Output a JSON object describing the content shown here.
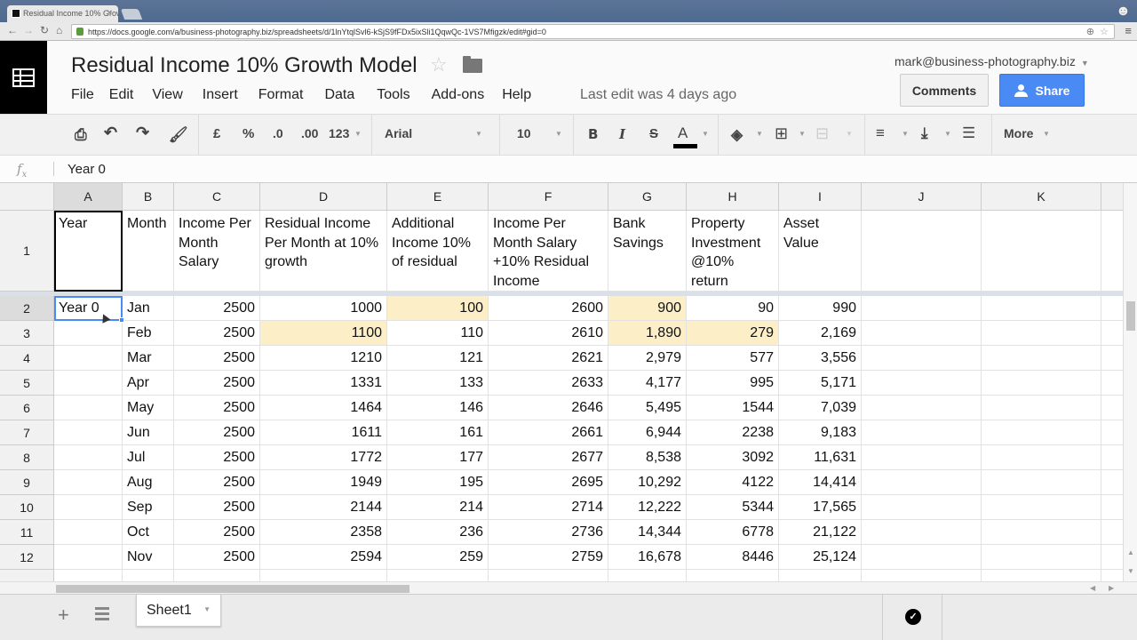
{
  "browser": {
    "tab_title": "Residual Income 10% Grow",
    "url": "https://docs.google.com/a/business-photography.biz/spreadsheets/d/1lnYtqlSvl6-kSjS9fFDx5ixSli1QqwQc-1VS7Mfigzk/edit#gid=0"
  },
  "app": {
    "doc_title": "Residual Income 10% Growth Model",
    "menus": [
      "File",
      "Edit",
      "View",
      "Insert",
      "Format",
      "Data",
      "Tools",
      "Add-ons",
      "Help"
    ],
    "last_edit": "Last edit was 4 days ago",
    "account": "mark@business-photography.biz",
    "comments_label": "Comments",
    "share_label": "Share"
  },
  "toolbar": {
    "currency": "£",
    "percent": "%",
    "dec_decrease": ".0",
    "dec_increase": ".00",
    "number_format": "123",
    "font": "Arial",
    "font_size": "10",
    "bold": "B",
    "italic": "I",
    "strike": "S",
    "text_color": "A",
    "more": "More"
  },
  "formula_bar": {
    "fx": "fx",
    "value": "Year 0"
  },
  "grid": {
    "columns": [
      "A",
      "B",
      "C",
      "D",
      "E",
      "F",
      "G",
      "H",
      "I",
      "J",
      "K"
    ],
    "selected_cell": "A2",
    "header_row": {
      "row": "1",
      "cells": [
        "Year",
        "Month",
        "Income Per Month Salary",
        "Residual Income Per Month at 10% growth",
        "Additional Income 10% of residual",
        "Income Per Month Salary +10% Residual Income",
        "Bank Savings",
        "Property Investment @10% return",
        "Asset Value",
        "",
        ""
      ]
    },
    "rows": [
      {
        "row": "2",
        "cells": [
          "Year 0",
          "Jan",
          "2500",
          "1000",
          "100",
          "2600",
          "900",
          "90",
          "990",
          "",
          ""
        ]
      },
      {
        "row": "3",
        "cells": [
          "",
          "Feb",
          "2500",
          "1100",
          "110",
          "2610",
          "1,890",
          "279",
          "2,169",
          "",
          ""
        ]
      },
      {
        "row": "4",
        "cells": [
          "",
          "Mar",
          "2500",
          "1210",
          "121",
          "2621",
          "2,979",
          "577",
          "3,556",
          "",
          ""
        ]
      },
      {
        "row": "5",
        "cells": [
          "",
          "Apr",
          "2500",
          "1331",
          "133",
          "2633",
          "4,177",
          "995",
          "5,171",
          "",
          ""
        ]
      },
      {
        "row": "6",
        "cells": [
          "",
          "May",
          "2500",
          "1464",
          "146",
          "2646",
          "5,495",
          "1544",
          "7,039",
          "",
          ""
        ]
      },
      {
        "row": "7",
        "cells": [
          "",
          "Jun",
          "2500",
          "1611",
          "161",
          "2661",
          "6,944",
          "2238",
          "9,183",
          "",
          ""
        ]
      },
      {
        "row": "8",
        "cells": [
          "",
          "Jul",
          "2500",
          "1772",
          "177",
          "2677",
          "8,538",
          "3092",
          "11,631",
          "",
          ""
        ]
      },
      {
        "row": "9",
        "cells": [
          "",
          "Aug",
          "2500",
          "1949",
          "195",
          "2695",
          "10,292",
          "4122",
          "14,414",
          "",
          ""
        ]
      },
      {
        "row": "10",
        "cells": [
          "",
          "Sep",
          "2500",
          "2144",
          "214",
          "2714",
          "12,222",
          "5344",
          "17,565",
          "",
          ""
        ]
      },
      {
        "row": "11",
        "cells": [
          "",
          "Oct",
          "2500",
          "2358",
          "236",
          "2736",
          "14,344",
          "6778",
          "21,122",
          "",
          ""
        ]
      },
      {
        "row": "12",
        "cells": [
          "",
          "Nov",
          "2500",
          "2594",
          "259",
          "2759",
          "16,678",
          "8446",
          "25,124",
          "",
          ""
        ]
      }
    ],
    "highlighted_cells": [
      "E2",
      "G2",
      "D3",
      "G3",
      "H3"
    ],
    "highlight_color": "#fcefc8"
  },
  "sheets": {
    "tabs": [
      "Sheet1"
    ],
    "active": "Sheet1"
  },
  "colors": {
    "accent": "#4a8af4",
    "selection": "#4a8af4"
  }
}
